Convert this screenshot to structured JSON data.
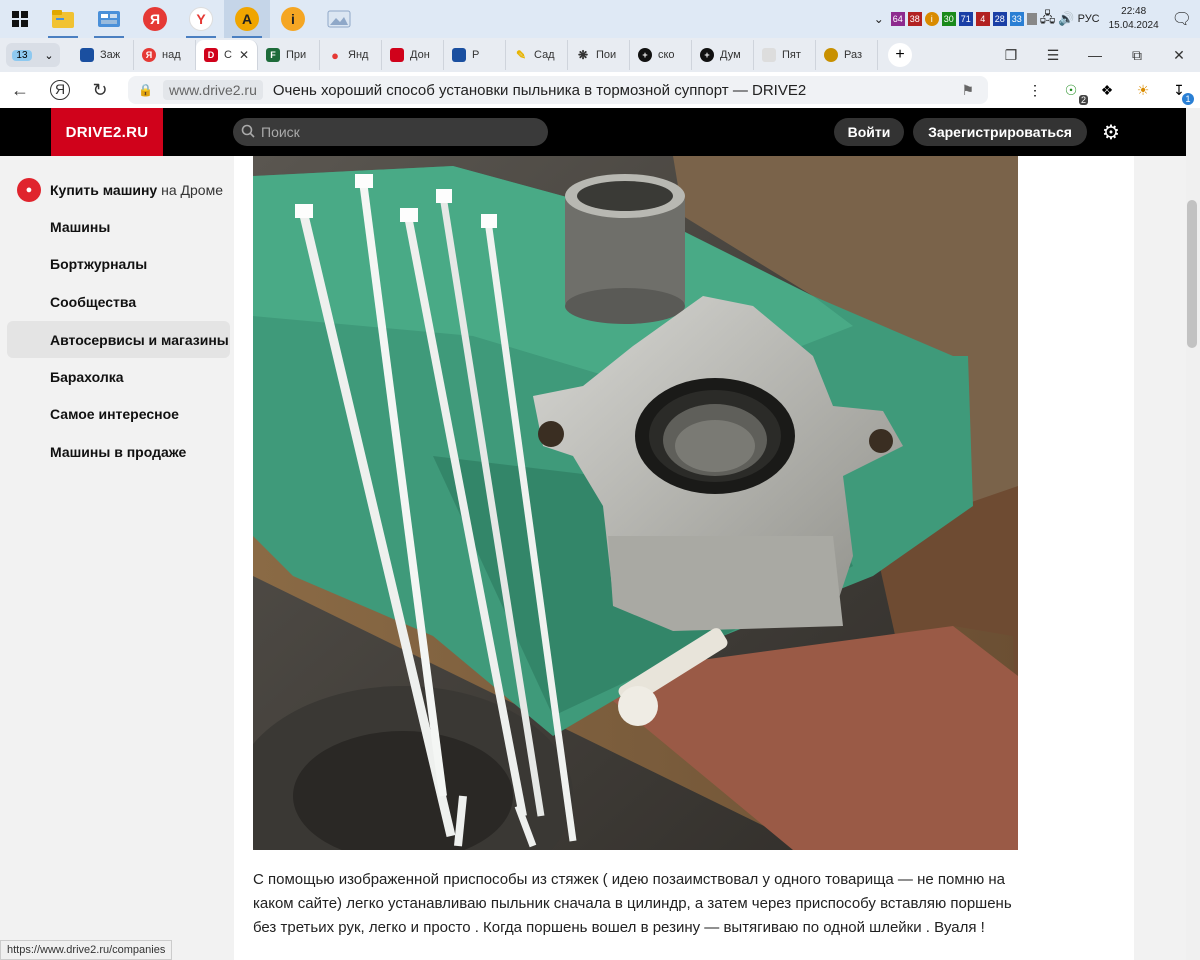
{
  "taskbar": {
    "apps": [
      {
        "name": "file-explorer",
        "color": "#f1c232"
      },
      {
        "name": "control-panel",
        "color": "#4a90d9"
      },
      {
        "name": "yandex-browser-red",
        "color": "#e53935",
        "glyph": "Я"
      },
      {
        "name": "yandex-browser",
        "color": "#e53935",
        "glyph": "Y"
      },
      {
        "name": "aimp",
        "color": "#f0a500",
        "glyph": "A"
      },
      {
        "name": "info-app",
        "color": "#f5a623",
        "glyph": "i"
      },
      {
        "name": "image-viewer",
        "color": "#8fa8c8"
      }
    ],
    "tray_badges": [
      {
        "text": "64",
        "color": "#8e2a8e"
      },
      {
        "text": "38",
        "color": "#b22222"
      },
      {
        "text": "i",
        "color": "#d98b00"
      },
      {
        "text": "30",
        "color": "#1a8a1a"
      },
      {
        "text": "71",
        "color": "#1a3fa6"
      },
      {
        "text": "4",
        "color": "#b22222"
      },
      {
        "text": "28",
        "color": "#1a3fa6"
      },
      {
        "text": "33",
        "color": "#2a7fd4"
      }
    ],
    "language": "РУС",
    "time": "22:48",
    "date": "15.04.2024"
  },
  "browser": {
    "tab_count": "13",
    "tabs": [
      {
        "label": "Заж",
        "favicon_color": "#1a4fa0",
        "icon": "shield-icon"
      },
      {
        "label": "над",
        "favicon_color": "#e53935",
        "icon": "yandex-icon"
      },
      {
        "label": "С",
        "favicon_color": "#d0021b",
        "icon": "drive2-icon",
        "active": true
      },
      {
        "label": "При",
        "favicon_color": "#1d6b3a",
        "icon": "f-icon"
      },
      {
        "label": "Янд",
        "favicon_color": "#e53935",
        "icon": "maps-pin-icon"
      },
      {
        "label": "Дон",
        "favicon_color": "#d0021b",
        "icon": "car-icon"
      },
      {
        "label": "Р",
        "favicon_color": "#1a4fa0",
        "icon": "shield-icon"
      },
      {
        "label": "Сад",
        "favicon_color": "#e8b400",
        "icon": "pencil-icon"
      },
      {
        "label": "Пои",
        "favicon_color": "#333333",
        "icon": "openai-icon"
      },
      {
        "label": "ско",
        "favicon_color": "#111111",
        "icon": "plus-circle-icon"
      },
      {
        "label": "Дум",
        "favicon_color": "#111111",
        "icon": "plus-circle-icon"
      },
      {
        "label": "Пят",
        "favicon_color": "#bbbbbb",
        "icon": "doc-icon"
      },
      {
        "label": "Раз",
        "favicon_color": "#c89000",
        "icon": "game-icon"
      }
    ],
    "url_domain": "www.drive2.ru",
    "page_title": "Очень хороший способ установки пыльника в тормозной суппорт — DRIVE2",
    "extension_badge": "2",
    "download_badge": "1"
  },
  "site": {
    "logo": "DRIVE2.RU",
    "search_placeholder": "Поиск",
    "login": "Войти",
    "register": "Зарегистрироваться",
    "accent": "#d0021b"
  },
  "sidebar": {
    "drom_bold": "Купить машину",
    "drom_light": "на Дроме",
    "items": [
      {
        "label": "Машины"
      },
      {
        "label": "Бортжурналы"
      },
      {
        "label": "Сообщества"
      },
      {
        "label": "Автосервисы и магазины",
        "active": true
      },
      {
        "label": "Барахолка"
      },
      {
        "label": "Самое интересное"
      },
      {
        "label": "Машины в продаже"
      }
    ]
  },
  "article": {
    "text": "С помощью изображенной приспособы из стяжек ( идею позаимствовал у одного товарища — не помню на каком сайте) легко устанавливаю пыльник сначала в цилиндр, а затем через приспособу вставляю поршень без третьих рук, легко и просто . Когда поршень вошел в резину — вытягиваю по одной шлейки . Вуаля !"
  },
  "status_url": "https://www.drive2.ru/companies"
}
